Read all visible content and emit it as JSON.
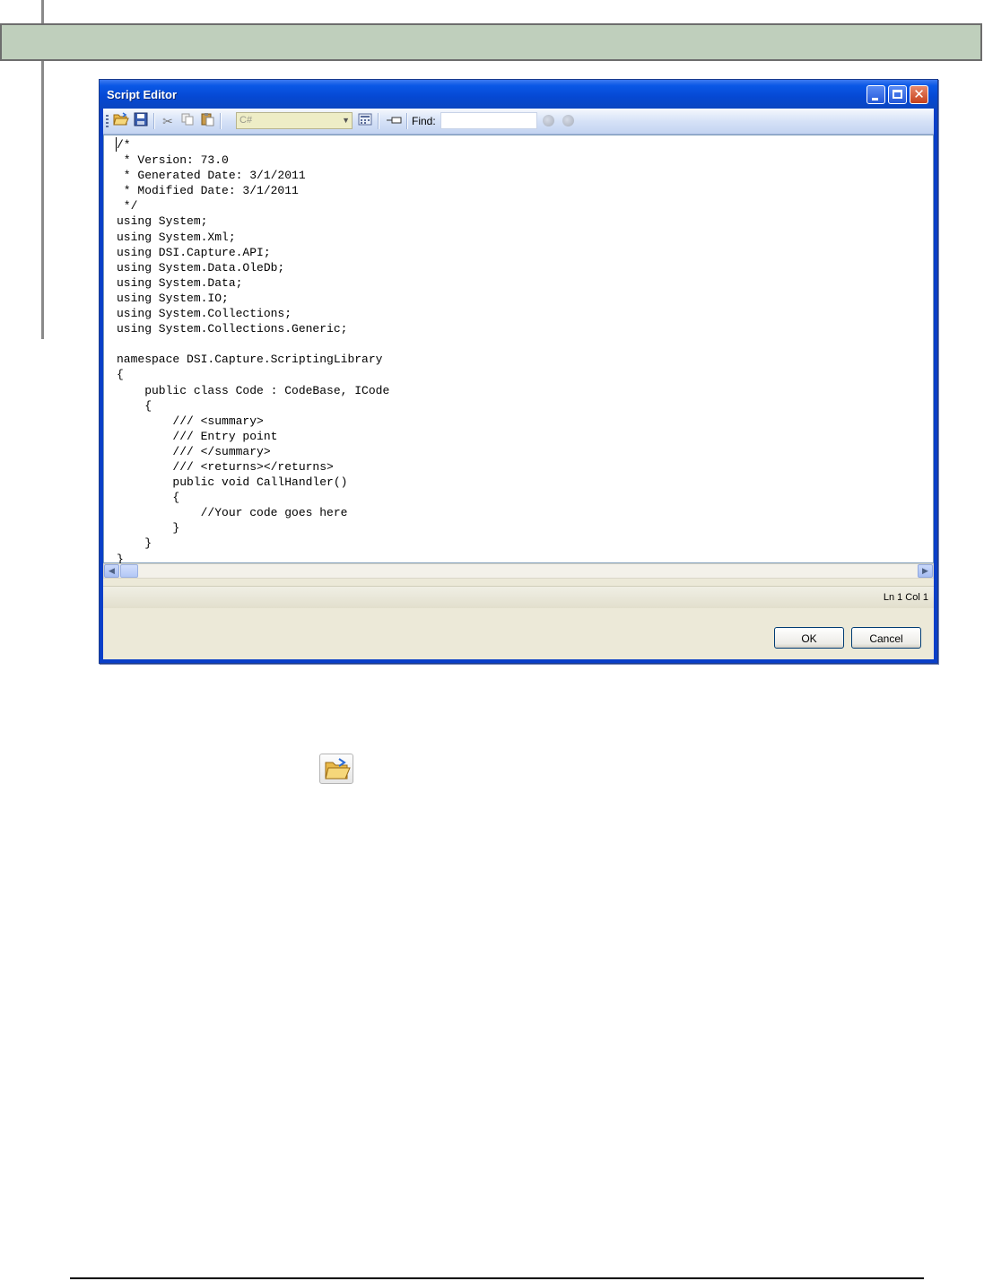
{
  "window": {
    "title": "Script Editor"
  },
  "toolbar": {
    "language_value": "C#",
    "find_label": "Find:",
    "find_value": "",
    "icons": [
      "open-folder-icon",
      "save-icon",
      "cut-icon",
      "copy-icon",
      "paste-icon",
      "calculator-icon",
      "insert-icon",
      "find-previous-icon",
      "find-next-icon"
    ]
  },
  "editor": {
    "code": "/*\n * Version: 73.0\n * Generated Date: 3/1/2011\n * Modified Date: 3/1/2011\n */\nusing System;\nusing System.Xml;\nusing DSI.Capture.API;\nusing System.Data.OleDb;\nusing System.Data;\nusing System.IO;\nusing System.Collections;\nusing System.Collections.Generic;\n\nnamespace DSI.Capture.ScriptingLibrary\n{\n    public class Code : CodeBase, ICode\n    {\n        /// <summary>\n        /// Entry point\n        /// </summary>\n        /// <returns></returns>\n        public void CallHandler()\n        {\n            //Your code goes here\n        }\n    }\n}"
  },
  "status": {
    "position": "Ln 1  Col 1"
  },
  "buttons": {
    "ok": "OK",
    "cancel": "Cancel"
  },
  "colors": {
    "titlebar": "#0548d3",
    "client_bg": "#ece9d8",
    "band": "#bfcfbc"
  }
}
